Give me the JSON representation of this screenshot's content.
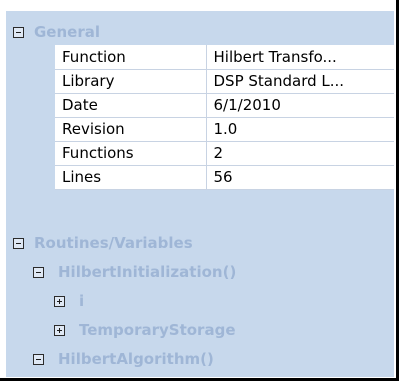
{
  "general": {
    "label": "General",
    "properties": [
      {
        "name": "Function",
        "value": "Hilbert Transfo..."
      },
      {
        "name": "Library",
        "value": "DSP Standard L..."
      },
      {
        "name": "Date",
        "value": "6/1/2010"
      },
      {
        "name": "Revision",
        "value": "1.0"
      },
      {
        "name": "Functions",
        "value": "2"
      },
      {
        "name": "Lines",
        "value": "56"
      }
    ]
  },
  "routines": {
    "label": "Routines/Variables",
    "hilbert_init": {
      "label": "HilbertInitialization()",
      "children": [
        {
          "label": "i"
        },
        {
          "label": "TemporaryStorage"
        }
      ]
    },
    "hilbert_algo": {
      "label": "HilbertAlgorithm()"
    }
  },
  "colors": {
    "panel_bg": "#c7d8ec",
    "group_text": "#9fb6d6",
    "value_bg": "#ffffff"
  }
}
